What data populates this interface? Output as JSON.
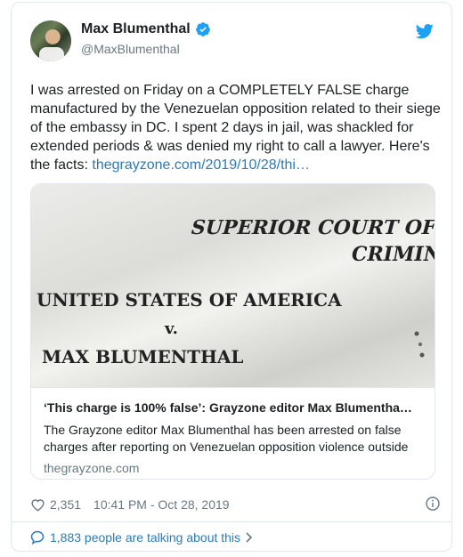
{
  "author": {
    "name": "Max Blumenthal",
    "handle": "@MaxBlumenthal"
  },
  "tweet": {
    "text": "I was arrested on Friday on a COMPLETELY FALSE charge manufactured by the Venezuelan opposition related to their siege of the embassy in DC. I spent 2 days in jail, was shackled for extended periods & was denied my right to call a lawyer. Here's the facts: ",
    "link": "thegrayzone.com/2019/10/28/thi…"
  },
  "card": {
    "image_lines": [
      "SUPERIOR COURT OF T",
      "CRIMIN",
      "UNITED STATES OF AMERICA",
      "v.",
      "MAX BLUMENTHAL"
    ],
    "title": "‘This charge is 100% false’: Grayzone editor Max Blumentha…",
    "description": "The Grayzone editor Max Blumenthal has been arrested on false charges after reporting on Venezuelan opposition violence outside",
    "domain": "thegrayzone.com"
  },
  "meta": {
    "likes": "2,351",
    "time": "10:41 PM - Oct 28, 2019"
  },
  "conversation": {
    "label": "1,883 people are talking about this"
  },
  "colors": {
    "link": "#2b7bb9",
    "muted": "#697882",
    "twitter_blue": "#1da1f2",
    "border": "#e1e8ed"
  },
  "icons": [
    "verified-badge-icon",
    "twitter-bird-icon",
    "heart-icon",
    "info-icon",
    "speech-bubble-icon",
    "chevron-right-icon"
  ]
}
